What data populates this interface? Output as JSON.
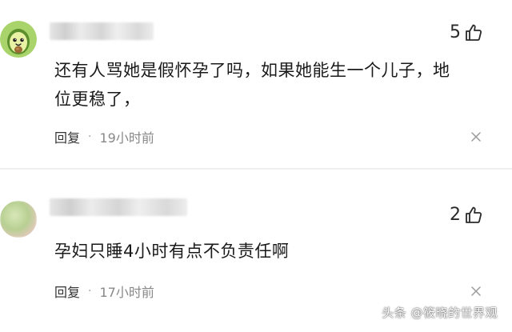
{
  "comments": [
    {
      "avatar_icon": "avocado-icon",
      "likes": "5",
      "text_line1": "还有人骂她是假怀孕了吗，如果她能生一个儿子，地",
      "text_line2": "位更稳了，",
      "reply_label": "回复",
      "separator": "·",
      "time": "19小时前"
    },
    {
      "avatar_icon": "blurred-avatar",
      "likes": "2",
      "text_line1": "孕妇只睡4小时有点不负责任啊",
      "reply_label": "回复",
      "separator": "·",
      "time": "17小时前"
    }
  ],
  "watermark": "头条 @筱晓的世界观"
}
